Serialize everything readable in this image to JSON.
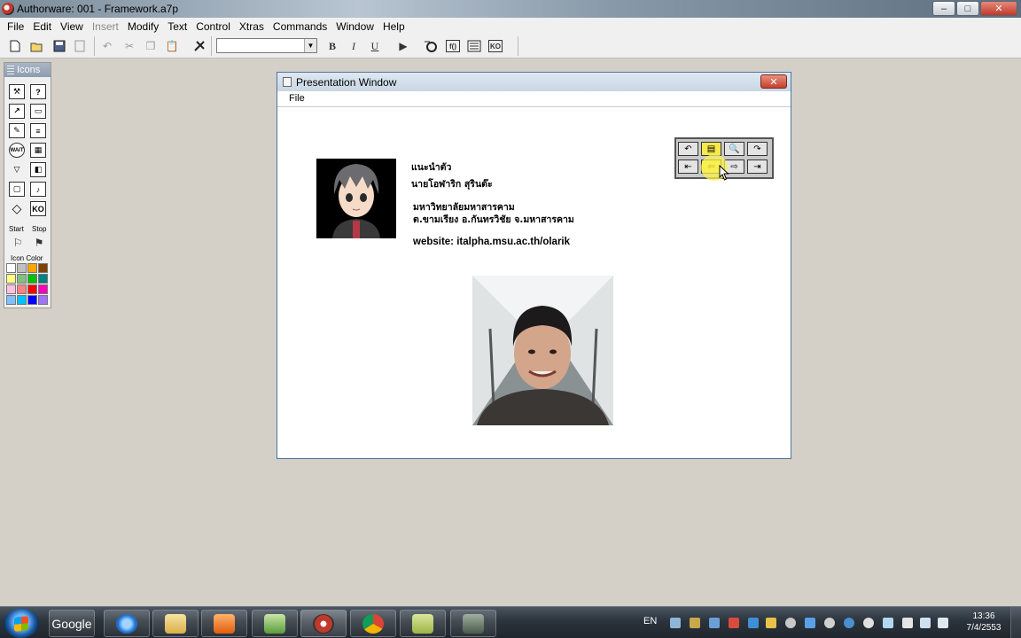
{
  "window": {
    "title": "Authorware: 001 - Framework.a7p",
    "controls": {
      "minimize": "–",
      "maximize": "□",
      "close": "✕"
    }
  },
  "menubar": {
    "items": [
      "File",
      "Edit",
      "View",
      "Insert",
      "Modify",
      "Text",
      "Control",
      "Xtras",
      "Commands",
      "Window",
      "Help"
    ],
    "disabled": [
      "Insert"
    ]
  },
  "toolbar": {
    "buttons": [
      "new",
      "open",
      "save",
      "import",
      "undo",
      "cut",
      "copy",
      "paste",
      "find"
    ],
    "bold": "B",
    "italic": "I",
    "underline": "U",
    "font_value": "",
    "ko_label": "KO"
  },
  "palette": {
    "title": "Icons",
    "start_label": "Start",
    "stop_label": "Stop",
    "icon_color_label": "Icon Color",
    "swatches": [
      "#ffffff",
      "#c0c0c0",
      "#ffa500",
      "#804000",
      "#ffff80",
      "#80c080",
      "#00c000",
      "#008080",
      "#ffc0e0",
      "#ff8080",
      "#ff0000",
      "#ff00c0",
      "#80c0ff",
      "#00c0ff",
      "#0000ff",
      "#a070ff"
    ]
  },
  "presentation": {
    "title": "Presentation Window",
    "menu_file": "File",
    "close": "✕",
    "intro": "แนะนำตัว",
    "name": "นายโอฬาริก สุรินต๊ะ",
    "university": "มหาวิทยาลัยมหาสารคาม",
    "address": "ต.ขามเรียง อ.กันทรวิชัย จ.มหาสารคาม",
    "website": "website: italpha.msu.ac.th/olarik"
  },
  "taskbar": {
    "google_label": "Google",
    "language": "EN",
    "time": "13:36",
    "date": "7/4/2553"
  }
}
